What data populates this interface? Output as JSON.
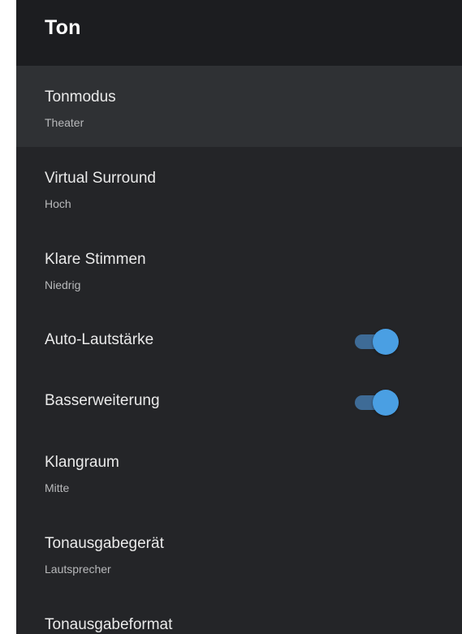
{
  "header": {
    "title": "Ton"
  },
  "colors": {
    "background": "#242528",
    "header_background": "#1c1d20",
    "focused_row": "#2f3134",
    "toggle_accent": "#4a9fe3"
  },
  "items": [
    {
      "title": "Tonmodus",
      "subtitle": "Theater",
      "focused": true
    },
    {
      "title": "Virtual Surround",
      "subtitle": "Hoch"
    },
    {
      "title": "Klare Stimmen",
      "subtitle": "Niedrig"
    },
    {
      "title": "Auto-Lautstärke",
      "toggle": true,
      "on": true
    },
    {
      "title": "Basserweiterung",
      "toggle": true,
      "on": true
    },
    {
      "title": "Klangraum",
      "subtitle": "Mitte"
    },
    {
      "title": "Tonausgabegerät",
      "subtitle": "Lautsprecher"
    },
    {
      "title": "Tonausgabeformat"
    }
  ]
}
